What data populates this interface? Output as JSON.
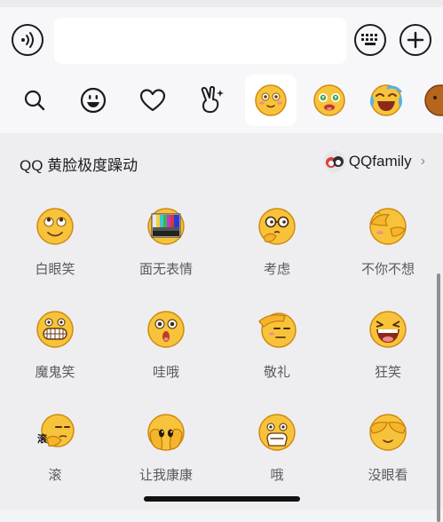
{
  "toolbar": {
    "voice_icon": "voice-wave-icon",
    "input_value": "",
    "keyboard_icon": "keyboard-icon",
    "add_icon": "plus-icon"
  },
  "tabs": [
    {
      "name": "search",
      "icon": "search-icon"
    },
    {
      "name": "emoji",
      "icon": "smiley-icon"
    },
    {
      "name": "favorites",
      "icon": "heart-icon"
    },
    {
      "name": "stickers",
      "icon": "peace-hand-icon"
    },
    {
      "name": "qq-yellow-face",
      "icon": "blushing-face-icon",
      "active": true
    },
    {
      "name": "pack-2",
      "icon": "money-eyes-face-icon"
    },
    {
      "name": "pack-3",
      "icon": "laughing-tears-face-icon"
    },
    {
      "name": "pack-4",
      "icon": "brown-face-icon"
    }
  ],
  "pack": {
    "title": "QQ 黄脸极度躁动",
    "author": "QQfamily",
    "chevron": "›"
  },
  "emojis": [
    {
      "label": "白眼笑",
      "icon": "eye-roll-smile-icon"
    },
    {
      "label": "面无表情",
      "icon": "test-pattern-face-icon"
    },
    {
      "label": "考虑",
      "icon": "thinking-glasses-face-icon"
    },
    {
      "label": "不你不想",
      "icon": "covering-face-icon"
    },
    {
      "label": "魔鬼笑",
      "icon": "evil-grin-icon"
    },
    {
      "label": "哇哦",
      "icon": "surprised-face-icon"
    },
    {
      "label": "敬礼",
      "icon": "salute-face-icon"
    },
    {
      "label": "狂笑",
      "icon": "crazy-laugh-icon"
    },
    {
      "label": "滚",
      "icon": "go-away-face-icon"
    },
    {
      "label": "让我康康",
      "icon": "peeking-face-icon"
    },
    {
      "label": "哦",
      "icon": "oh-face-icon"
    },
    {
      "label": "没眼看",
      "icon": "hands-over-eyes-icon"
    }
  ],
  "colors": {
    "face_yellow": "#f7c33a",
    "face_outline": "#d08a12",
    "panel_bg": "#eeeef0",
    "toolbar_bg": "#f7f7f9"
  }
}
